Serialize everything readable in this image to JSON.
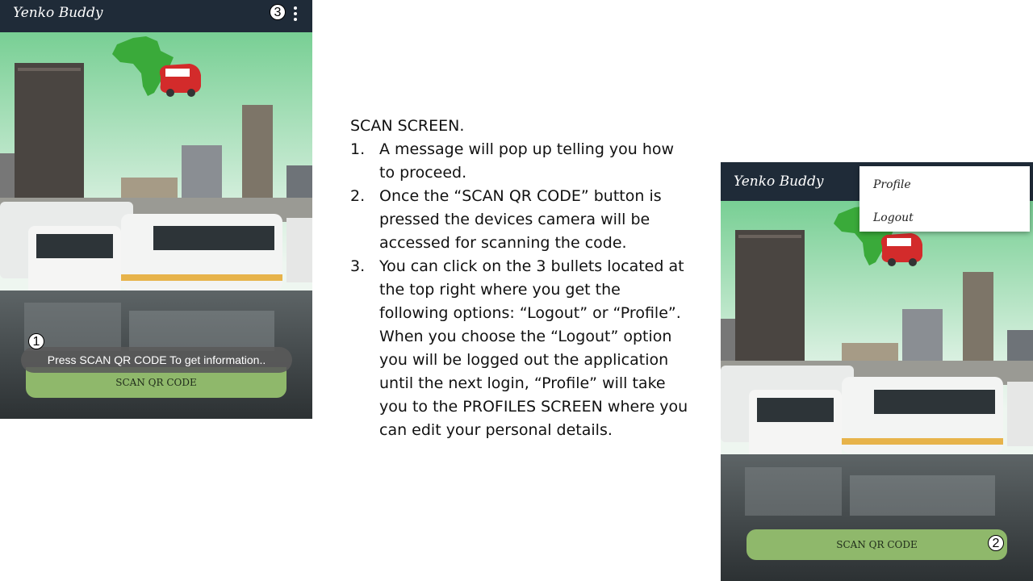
{
  "app": {
    "title": "Yenko Buddy"
  },
  "left_screen": {
    "toast": "Press SCAN QR CODE To get information..",
    "scan_button": "SCAN QR CODE",
    "badge_toast": "1",
    "badge_menu": "3"
  },
  "right_screen": {
    "menu": {
      "items": [
        "Profile",
        "Logout"
      ]
    },
    "scan_button": "SCAN QR CODE",
    "badge_button": "2"
  },
  "instructions": {
    "heading": "SCAN SCREEN.",
    "items": [
      {
        "num": "1.",
        "text": "A message will pop up telling you how to proceed."
      },
      {
        "num": "2.",
        "text": "Once the “SCAN QR CODE” button is pressed the devices camera will be accessed for scanning the code."
      },
      {
        "num": "3.",
        "text": "You can click on the 3 bullets located at the top right where you get the following options: “Logout” or “Profile”. When you choose the “Logout” option you will be logged out the application until the next login, “Profile” will take you to the PROFILES SCREEN where you can edit your personal details."
      }
    ]
  },
  "colors": {
    "appbar": "#1f2b38",
    "button": "#8fb86b",
    "sky_top": "#6fcf8f",
    "sky_bottom": "#e4f2ea"
  }
}
